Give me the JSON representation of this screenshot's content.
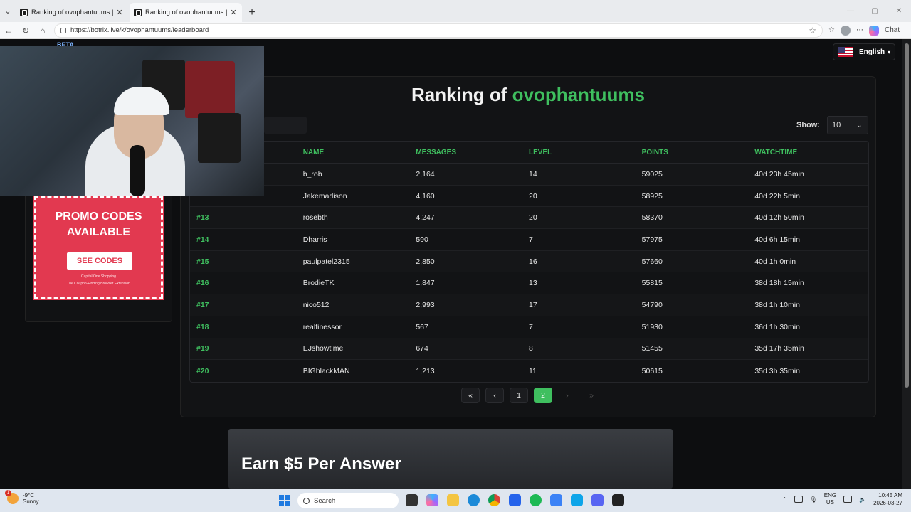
{
  "browser": {
    "tabs": [
      {
        "title": "Ranking of ovophantuums | BotRix"
      },
      {
        "title": "Ranking of ovophantuums | BotRix"
      }
    ],
    "url": "https://botrix.live/k/ovophantuums/leaderboard",
    "chat_label": "Chat"
  },
  "site": {
    "beta": "BETA",
    "language": "English"
  },
  "promo": {
    "title": "PROMO CODES AVAILABLE",
    "button": "SEE CODES",
    "brand": "Capital One Shopping",
    "sub": "The Coupon-Finding Browser Extension"
  },
  "leaderboard": {
    "heading_prefix": "Ranking of",
    "channel": "ovophantuums",
    "show_label": "Show:",
    "show_value": "10",
    "columns": [
      "NAME",
      "MESSAGES",
      "LEVEL",
      "POINTS",
      "WATCHTIME"
    ],
    "rows": [
      {
        "rank": "",
        "name": "b_rob",
        "messages": "2,164",
        "level": "14",
        "points": "59025",
        "watchtime": "40d 23h 45min"
      },
      {
        "rank": "",
        "name": "Jakemadison",
        "messages": "4,160",
        "level": "20",
        "points": "58925",
        "watchtime": "40d 22h 5min"
      },
      {
        "rank": "#13",
        "name": "rosebth",
        "messages": "4,247",
        "level": "20",
        "points": "58370",
        "watchtime": "40d 12h 50min"
      },
      {
        "rank": "#14",
        "name": "Dharris",
        "messages": "590",
        "level": "7",
        "points": "57975",
        "watchtime": "40d 6h 15min"
      },
      {
        "rank": "#15",
        "name": "paulpatel2315",
        "messages": "2,850",
        "level": "16",
        "points": "57660",
        "watchtime": "40d 1h 0min"
      },
      {
        "rank": "#16",
        "name": "BrodieTK",
        "messages": "1,847",
        "level": "13",
        "points": "55815",
        "watchtime": "38d 18h 15min"
      },
      {
        "rank": "#17",
        "name": "nico512",
        "messages": "2,993",
        "level": "17",
        "points": "54790",
        "watchtime": "38d 1h 10min"
      },
      {
        "rank": "#18",
        "name": "realfinessor",
        "messages": "567",
        "level": "7",
        "points": "51930",
        "watchtime": "36d 1h 30min"
      },
      {
        "rank": "#19",
        "name": "EJshowtime",
        "messages": "674",
        "level": "8",
        "points": "51455",
        "watchtime": "35d 17h 35min"
      },
      {
        "rank": "#20",
        "name": "BIGblackMAN",
        "messages": "1,213",
        "level": "11",
        "points": "50615",
        "watchtime": "35d 3h 35min"
      }
    ],
    "pagination": {
      "first": "«",
      "prev": "‹",
      "pages": [
        "1",
        "2"
      ],
      "current": "2",
      "next": "›",
      "last": "»"
    }
  },
  "earn_ad": {
    "text": "Earn $5 Per Answer"
  },
  "taskbar": {
    "weather_temp": "-9°C",
    "weather_desc": "Sunny",
    "weather_badge": "1",
    "search_label": "Search",
    "lang_top": "ENG",
    "lang_bottom": "US",
    "time": "10:45 AM",
    "date": "2026-03-27"
  },
  "colors": {
    "accent_green": "#3fbf5f",
    "promo_red": "#e23950"
  }
}
